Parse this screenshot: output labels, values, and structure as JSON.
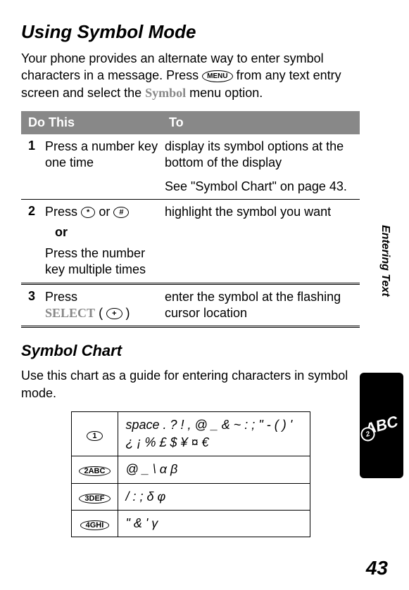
{
  "heading": "Using Symbol Mode",
  "intro1": "Your phone provides an alternate way to enter symbol characters in a message. Press ",
  "intro_menu_label": "MENU",
  "intro2": " from any text entry screen and select the ",
  "intro_symbol": "Symbol",
  "intro3": " menu option.",
  "th_do": "Do This",
  "th_to": "To",
  "rows": {
    "r1_num": "1",
    "r1_do": "Press a number key one time",
    "r1_to": "display its symbol options at the bottom of the display",
    "r1_to2": "See \"Symbol Chart\" on page 43.",
    "r2_num": "2",
    "r2_do_a": "Press ",
    "r2_star": "*",
    "r2_do_b": " or ",
    "r2_hash": "#",
    "r2_or": "or",
    "r2_do_c": "Press the number key multiple times",
    "r2_to": "highlight the symbol you want",
    "r3_num": "3",
    "r3_do_a": "Press ",
    "r3_select": "SELECT",
    "r3_paren_open": " (",
    "r3_softkey": "+",
    "r3_paren_close": ")",
    "r3_to": "enter the symbol at the flashing cursor location"
  },
  "chart_heading": "Symbol Chart",
  "chart_intro": "Use this chart as a guide for entering characters in symbol mode.",
  "symbol_rows": [
    {
      "key": "1",
      "chars": "space  .  ?  !  ,  @  _  &  ~  :  ;  \"  -  (  )  '  ¿  ¡  %  £  $  ¥  ¤  €"
    },
    {
      "key": "2ABC",
      "chars": "@  _  \\  α  β"
    },
    {
      "key": "3DEF",
      "chars": "/  :  ;  δ  φ"
    },
    {
      "key": "4GHI",
      "chars": "\"  &  '  γ"
    }
  ],
  "side_tab": "Entering Text",
  "abc_badge": "ABC",
  "abc_key": "2",
  "page_num": "43"
}
